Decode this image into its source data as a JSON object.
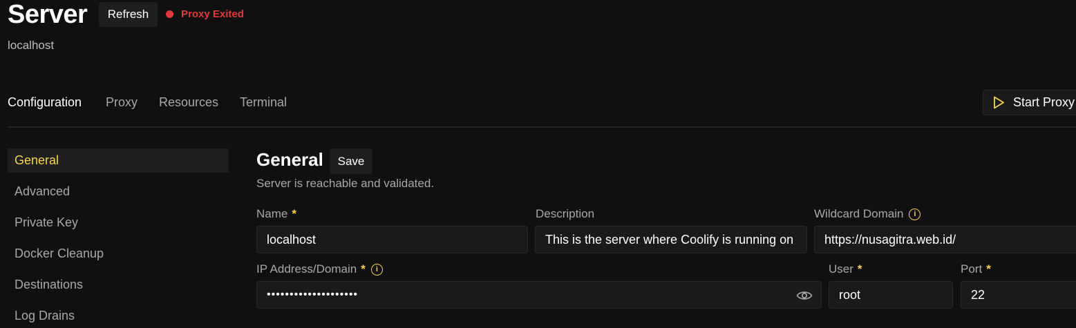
{
  "header": {
    "title": "Server",
    "refresh_label": "Refresh",
    "status": {
      "text": "Proxy Exited",
      "color": "#e5383b"
    },
    "subtitle": "localhost"
  },
  "tabs": [
    {
      "label": "Configuration",
      "active": true
    },
    {
      "label": "Proxy",
      "active": false
    },
    {
      "label": "Resources",
      "active": false
    },
    {
      "label": "Terminal",
      "active": false
    }
  ],
  "actions": {
    "start_proxy_label": "Start Proxy",
    "start_proxy_icon": "play-icon"
  },
  "sidebar": {
    "items": [
      {
        "label": "General",
        "active": true
      },
      {
        "label": "Advanced",
        "active": false
      },
      {
        "label": "Private Key",
        "active": false
      },
      {
        "label": "Docker Cleanup",
        "active": false
      },
      {
        "label": "Destinations",
        "active": false
      },
      {
        "label": "Log Drains",
        "active": false
      }
    ]
  },
  "general": {
    "title": "General",
    "save_label": "Save",
    "status_text": "Server is reachable and validated.",
    "fields": {
      "name": {
        "label": "Name",
        "required": "*",
        "value": "localhost"
      },
      "description": {
        "label": "Description",
        "value": "This is the server where Coolify is running on"
      },
      "wildcard": {
        "label": "Wildcard Domain",
        "value": "https://nusagitra.web.id/",
        "icon": "info-icon"
      },
      "ip": {
        "label": "IP Address/Domain",
        "required": "*",
        "value": "••••••••••••••••••••",
        "icon": "info-icon",
        "toggle_icon": "eye-icon"
      },
      "user": {
        "label": "User",
        "required": "*",
        "value": "root"
      },
      "port": {
        "label": "Port",
        "required": "*",
        "value": "22"
      }
    }
  },
  "colors": {
    "accent": "#fcd34d",
    "background": "#101010",
    "error": "#e5383b"
  }
}
